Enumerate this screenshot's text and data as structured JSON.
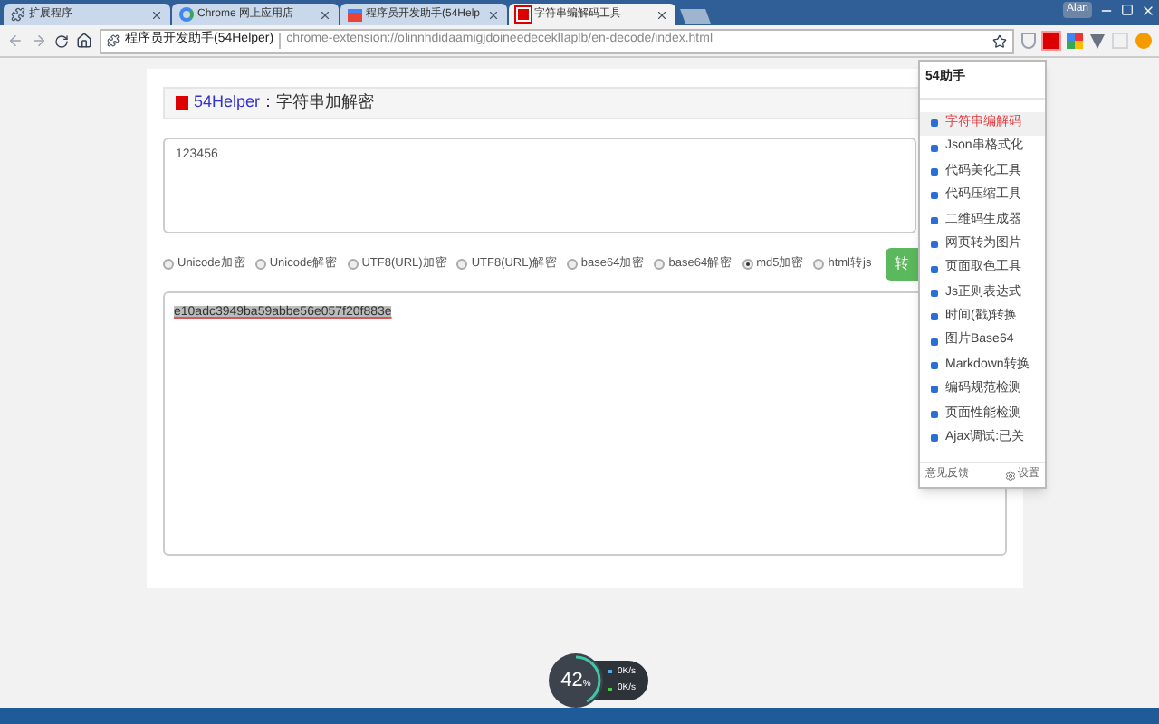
{
  "window": {
    "user": "Alan"
  },
  "tabs": [
    {
      "title": "扩展程序",
      "selected": false
    },
    {
      "title": "Chrome 网上应用店",
      "selected": false
    },
    {
      "title": "程序员开发助手(54Help",
      "selected": false
    },
    {
      "title": "字符串编解码工具",
      "selected": true
    }
  ],
  "address_bar": {
    "site": "程序员开发助手(54Helper)",
    "url": "chrome-extension://olinnhdidaamigjdoineedeceklIaplb/en-decode/index.html"
  },
  "card": {
    "brand": "54Helper",
    "title": "：字符串加解密"
  },
  "input": {
    "value": "123456"
  },
  "options": [
    {
      "label": "Unicode加密",
      "selected": false
    },
    {
      "label": "Unicode解密",
      "selected": false
    },
    {
      "label": "UTF8(URL)加密",
      "selected": false
    },
    {
      "label": "UTF8(URL)解密",
      "selected": false
    },
    {
      "label": "base64加密",
      "selected": false
    },
    {
      "label": "base64解密",
      "selected": false
    },
    {
      "label": "md5加密",
      "selected": true
    },
    {
      "label": "html转js",
      "selected": false
    }
  ],
  "convert_button": "转",
  "output": {
    "value": "e10adc3949ba59abbe56e057f20f883e"
  },
  "popup": {
    "title": "54助手",
    "items": [
      {
        "label": "字符串编解码",
        "selected": true
      },
      {
        "label": "Json串格式化",
        "selected": false
      },
      {
        "label": "代码美化工具",
        "selected": false
      },
      {
        "label": "代码压缩工具",
        "selected": false
      },
      {
        "label": "二维码生成器",
        "selected": false
      },
      {
        "label": "网页转为图片",
        "selected": false
      },
      {
        "label": "页面取色工具",
        "selected": false
      },
      {
        "label": "Js正则表达式",
        "selected": false
      },
      {
        "label": "时间(戳)转换",
        "selected": false
      },
      {
        "label": "图片Base64",
        "selected": false
      },
      {
        "label": "Markdown转换",
        "selected": false
      },
      {
        "label": "编码规范检测",
        "selected": false
      },
      {
        "label": "页面性能检测",
        "selected": false
      },
      {
        "label": "Ajax调试:已关",
        "selected": false
      }
    ],
    "feedback": "意见反馈",
    "settings": "设置"
  },
  "monitor": {
    "percent": "42",
    "unit": "%",
    "level": 0.42,
    "upload": "0K/s",
    "download": "0K/s"
  }
}
